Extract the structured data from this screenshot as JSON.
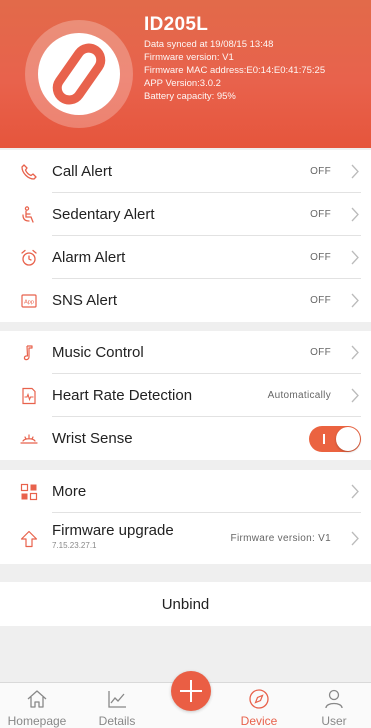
{
  "device": {
    "name": "ID205L",
    "synced": "Data synced at 19/08/15 13:48",
    "firmware": "Firmware version: V1",
    "mac": "Firmware MAC address:E0:14:E0:41:75:25",
    "app_version": "APP Version:3.0.2",
    "battery": "Battery capacity: 95%"
  },
  "alerts": [
    {
      "label": "Call Alert",
      "value": "OFF",
      "icon": "phone-icon"
    },
    {
      "label": "Sedentary Alert",
      "value": "OFF",
      "icon": "sedentary-icon"
    },
    {
      "label": "Alarm Alert",
      "value": "OFF",
      "icon": "alarm-clock-icon"
    },
    {
      "label": "SNS Alert",
      "value": "OFF",
      "icon": "app-icon"
    }
  ],
  "controls": [
    {
      "label": "Music Control",
      "value": "OFF",
      "icon": "music-note-icon"
    },
    {
      "label": "Heart Rate Detection",
      "value": "Automatically",
      "icon": "heart-rate-icon"
    },
    {
      "label": "Wrist Sense",
      "toggle": true,
      "icon": "wrist-sense-icon"
    }
  ],
  "more": {
    "label": "More",
    "icon": "grid-icon"
  },
  "firmware_upgrade": {
    "label": "Firmware upgrade",
    "sublabel": "7.15.23.27.1",
    "value": "Firmware version: V1",
    "icon": "upgrade-arrow-icon"
  },
  "unbind_label": "Unbind",
  "tabs": [
    {
      "label": "Homepage",
      "icon": "home-icon",
      "active": false
    },
    {
      "label": "Details",
      "icon": "chart-icon",
      "active": false
    },
    {
      "label": "Device",
      "icon": "compass-icon",
      "active": true
    },
    {
      "label": "User",
      "icon": "user-icon",
      "active": false
    }
  ],
  "colors": {
    "accent": "#e8624c",
    "background": "#efefef"
  }
}
